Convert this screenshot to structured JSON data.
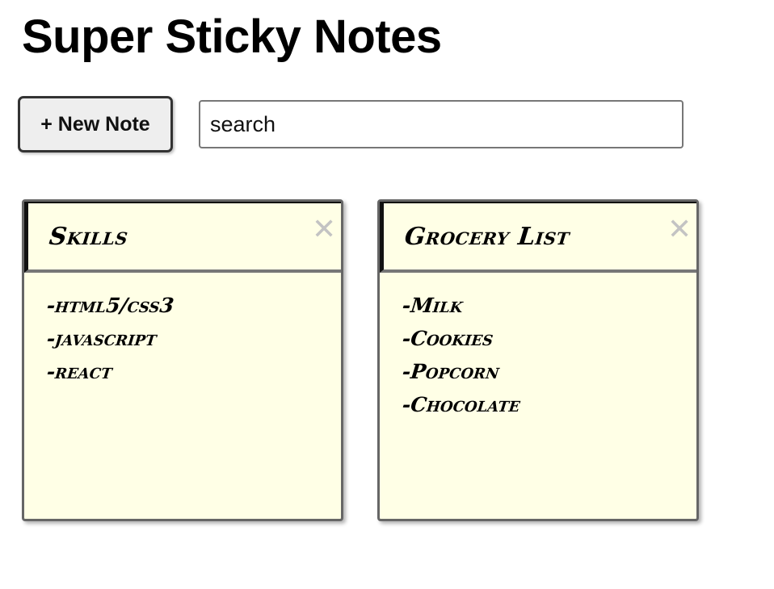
{
  "app": {
    "title": "Super Sticky Notes"
  },
  "toolbar": {
    "new_note_label": "+ New Note"
  },
  "search": {
    "placeholder": "search"
  },
  "notes": [
    {
      "title": "Skills",
      "close_glyph": "✕",
      "lines": [
        "-html5/css3",
        "-javascript",
        "-react"
      ]
    },
    {
      "title": "Grocery List",
      "close_glyph": "✕",
      "lines": [
        "-Milk",
        "-Cookies",
        "-Popcorn",
        "-Chocolate"
      ]
    }
  ]
}
